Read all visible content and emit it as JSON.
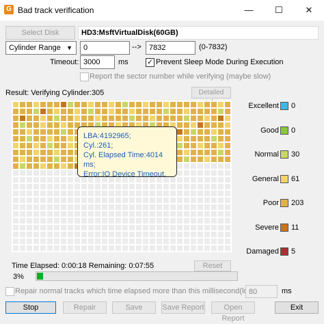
{
  "window": {
    "title": "Bad track verification",
    "minimize": "—",
    "maximize": "☐",
    "close": "✕"
  },
  "disk": {
    "select_label": "Select Disk",
    "name": "HD3:MsftVirtualDisk(60GB)"
  },
  "range": {
    "mode": "Cylinder Range",
    "from": "0",
    "arrow": "-->",
    "to": "7832",
    "bounds": "(0-7832)"
  },
  "timeout": {
    "label": "Timeout:",
    "value": "3000",
    "unit": "ms"
  },
  "options": {
    "prevent_sleep": "Prevent Sleep Mode During Execution",
    "report_sector": "Report the sector number while verifying (maybe slow)"
  },
  "result": {
    "label": "Result:  Verifying Cylinder:305",
    "detail_button": "Detailed Info"
  },
  "legend": [
    {
      "label": "Excellent",
      "count": "0",
      "color": "#41b6e6"
    },
    {
      "label": "Good",
      "count": "0",
      "color": "#8cc63f"
    },
    {
      "label": "Normal",
      "count": "30",
      "color": "#c8d66a"
    },
    {
      "label": "General",
      "count": "61",
      "color": "#f2d46b"
    },
    {
      "label": "Poor",
      "count": "203",
      "color": "#e0b24a"
    },
    {
      "label": "Severe",
      "count": "11",
      "color": "#c4761e"
    },
    {
      "label": "Damaged",
      "count": "5",
      "color": "#a83232"
    }
  ],
  "tooltip": {
    "lba": "LBA:4192965;",
    "cyl": "Cyl.:261;",
    "elapsed": "Cyl. Elapsed Time:4014 ms;",
    "error": "Error:IO Device Timeout."
  },
  "status": {
    "time_elapsed": "Time Elapsed:  0:00:18   Remaining:  0:07:55",
    "reset": "Reset",
    "percent_label": "3%",
    "progress": 0.03
  },
  "repair_option": {
    "label": "Repair normal tracks which time elapsed more than this millisecond(lossless):",
    "value": "80",
    "unit": "ms"
  },
  "buttons": {
    "stop": "Stop",
    "repair": "Repair",
    "save": "Save",
    "save_report": "Save Report",
    "open_report": "Open Report",
    "exit": "Exit"
  }
}
